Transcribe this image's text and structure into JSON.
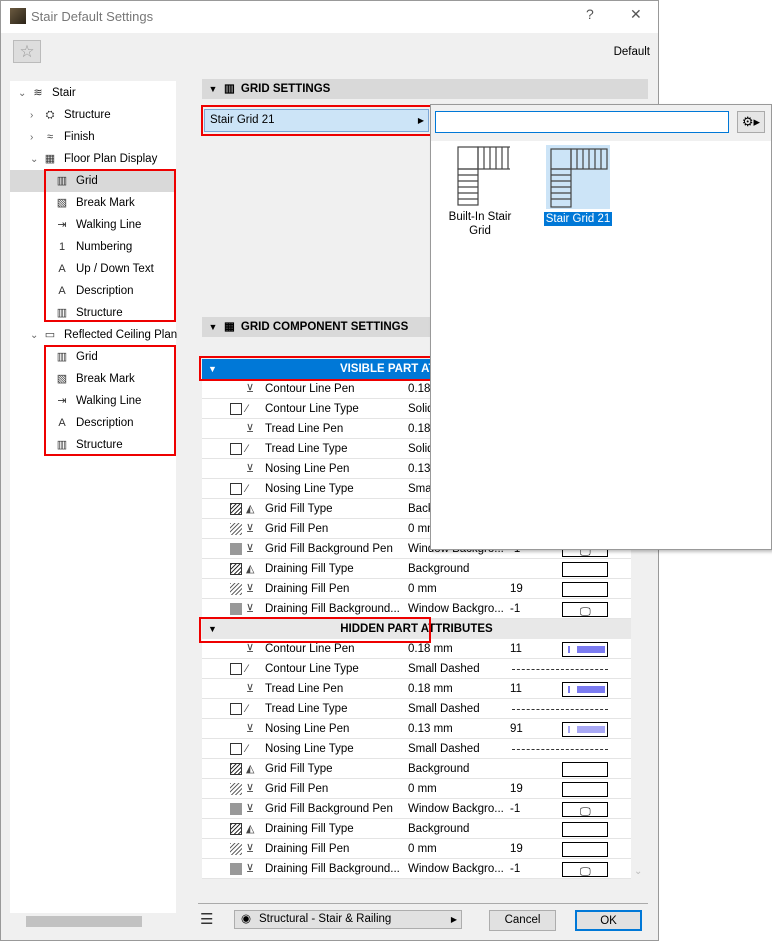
{
  "window": {
    "title": "Stair Default Settings",
    "help": "?",
    "close": "✕",
    "favorites_icon": "star-icon",
    "preset": "Default"
  },
  "tree": [
    {
      "label": "Stair",
      "level": 0,
      "expander": "open",
      "icon": "stair-icon"
    },
    {
      "label": "Structure",
      "level": 1,
      "expander": "closed",
      "icon": "structure-icon"
    },
    {
      "label": "Finish",
      "level": 1,
      "expander": "closed",
      "icon": "finish-icon"
    },
    {
      "label": "Floor Plan Display",
      "level": 1,
      "expander": "open",
      "icon": "floor-plan-icon"
    },
    {
      "label": "Grid",
      "level": 2,
      "icon": "grid-icon",
      "selected": true
    },
    {
      "label": "Break Mark",
      "level": 2,
      "icon": "break-mark-icon"
    },
    {
      "label": "Walking Line",
      "level": 2,
      "icon": "walking-line-icon"
    },
    {
      "label": "Numbering",
      "level": 2,
      "icon": "numbering-icon"
    },
    {
      "label": "Up / Down Text",
      "level": 2,
      "icon": "text-icon"
    },
    {
      "label": "Description",
      "level": 2,
      "icon": "text-icon"
    },
    {
      "label": "Structure",
      "level": 2,
      "icon": "structure-plan-icon"
    },
    {
      "label": "Reflected Ceiling Plan",
      "level": 1,
      "expander": "open",
      "icon": "ceiling-plan-icon"
    },
    {
      "label": "Grid",
      "level": 2,
      "icon": "grid-icon"
    },
    {
      "label": "Break Mark",
      "level": 2,
      "icon": "break-mark-icon"
    },
    {
      "label": "Walking Line",
      "level": 2,
      "icon": "walking-line-icon"
    },
    {
      "label": "Description",
      "level": 2,
      "icon": "text-icon"
    },
    {
      "label": "Structure",
      "level": 2,
      "icon": "structure-plan-icon"
    }
  ],
  "grid_settings": {
    "header": "GRID SETTINGS",
    "selected": "Stair Grid 21"
  },
  "popup": {
    "search_value": "",
    "items": [
      {
        "label": "Built-In Stair Grid",
        "selected": false
      },
      {
        "label": "Stair Grid 21",
        "selected": true
      }
    ]
  },
  "component_settings": {
    "header": "GRID COMPONENT SETTINGS",
    "visible": {
      "header": "VISIBLE PART ATTRIBUTES",
      "rows": [
        {
          "name": "Contour Line Pen",
          "value": "0.18 mm",
          "num": "",
          "kind": "pen"
        },
        {
          "name": "Contour Line Type",
          "value": "Solid",
          "num": "",
          "kind": "line"
        },
        {
          "name": "Tread Line Pen",
          "value": "0.18 mm",
          "num": "",
          "kind": "pen"
        },
        {
          "name": "Tread Line Type",
          "value": "Solid",
          "num": "",
          "kind": "line"
        },
        {
          "name": "Nosing Line Pen",
          "value": "0.13 mm",
          "num": "",
          "kind": "pen"
        },
        {
          "name": "Nosing Line Type",
          "value": "Small Dashed",
          "num": "",
          "kind": "line"
        },
        {
          "name": "Grid Fill Type",
          "value": "Background",
          "num": "",
          "kind": "filltype"
        },
        {
          "name": "Grid Fill Pen",
          "value": "0 mm",
          "num": "19",
          "kind": "fillpen"
        },
        {
          "name": "Grid Fill Background Pen",
          "value": "Window Backgro...",
          "num": "-1",
          "kind": "bgpen"
        },
        {
          "name": "Draining Fill Type",
          "value": "Background",
          "num": "",
          "kind": "filltype"
        },
        {
          "name": "Draining Fill Pen",
          "value": "0 mm",
          "num": "19",
          "kind": "fillpen"
        },
        {
          "name": "Draining Fill Background...",
          "value": "Window Backgro...",
          "num": "-1",
          "kind": "bgpen"
        }
      ]
    },
    "hidden": {
      "header": "HIDDEN PART ATTRIBUTES",
      "rows": [
        {
          "name": "Contour Line Pen",
          "value": "0.18 mm",
          "num": "11",
          "kind": "pen",
          "color": "#7b7bf0"
        },
        {
          "name": "Contour Line Type",
          "value": "Small Dashed",
          "num": "",
          "kind": "line"
        },
        {
          "name": "Tread Line Pen",
          "value": "0.18 mm",
          "num": "11",
          "kind": "pen",
          "color": "#7b7bf0"
        },
        {
          "name": "Tread Line Type",
          "value": "Small Dashed",
          "num": "",
          "kind": "line"
        },
        {
          "name": "Nosing Line Pen",
          "value": "0.13 mm",
          "num": "91",
          "kind": "pen",
          "color": "#a8a8f4"
        },
        {
          "name": "Nosing Line Type",
          "value": "Small Dashed",
          "num": "",
          "kind": "line"
        },
        {
          "name": "Grid Fill Type",
          "value": "Background",
          "num": "",
          "kind": "filltype"
        },
        {
          "name": "Grid Fill Pen",
          "value": "0 mm",
          "num": "19",
          "kind": "fillpen"
        },
        {
          "name": "Grid Fill Background Pen",
          "value": "Window Backgro...",
          "num": "-1",
          "kind": "bgpen"
        },
        {
          "name": "Draining Fill Type",
          "value": "Background",
          "num": "",
          "kind": "filltype"
        },
        {
          "name": "Draining Fill Pen",
          "value": "0 mm",
          "num": "19",
          "kind": "fillpen"
        },
        {
          "name": "Draining Fill Background...",
          "value": "Window Backgro...",
          "num": "-1",
          "kind": "bgpen"
        }
      ]
    }
  },
  "footer": {
    "layer_icon": "layers-icon",
    "view": "Structural - Stair & Railing",
    "cancel": "Cancel",
    "ok": "OK"
  },
  "colors": {
    "accent": "#0078d7",
    "highlight": "#cce4f7",
    "annotation": "#e00000"
  }
}
